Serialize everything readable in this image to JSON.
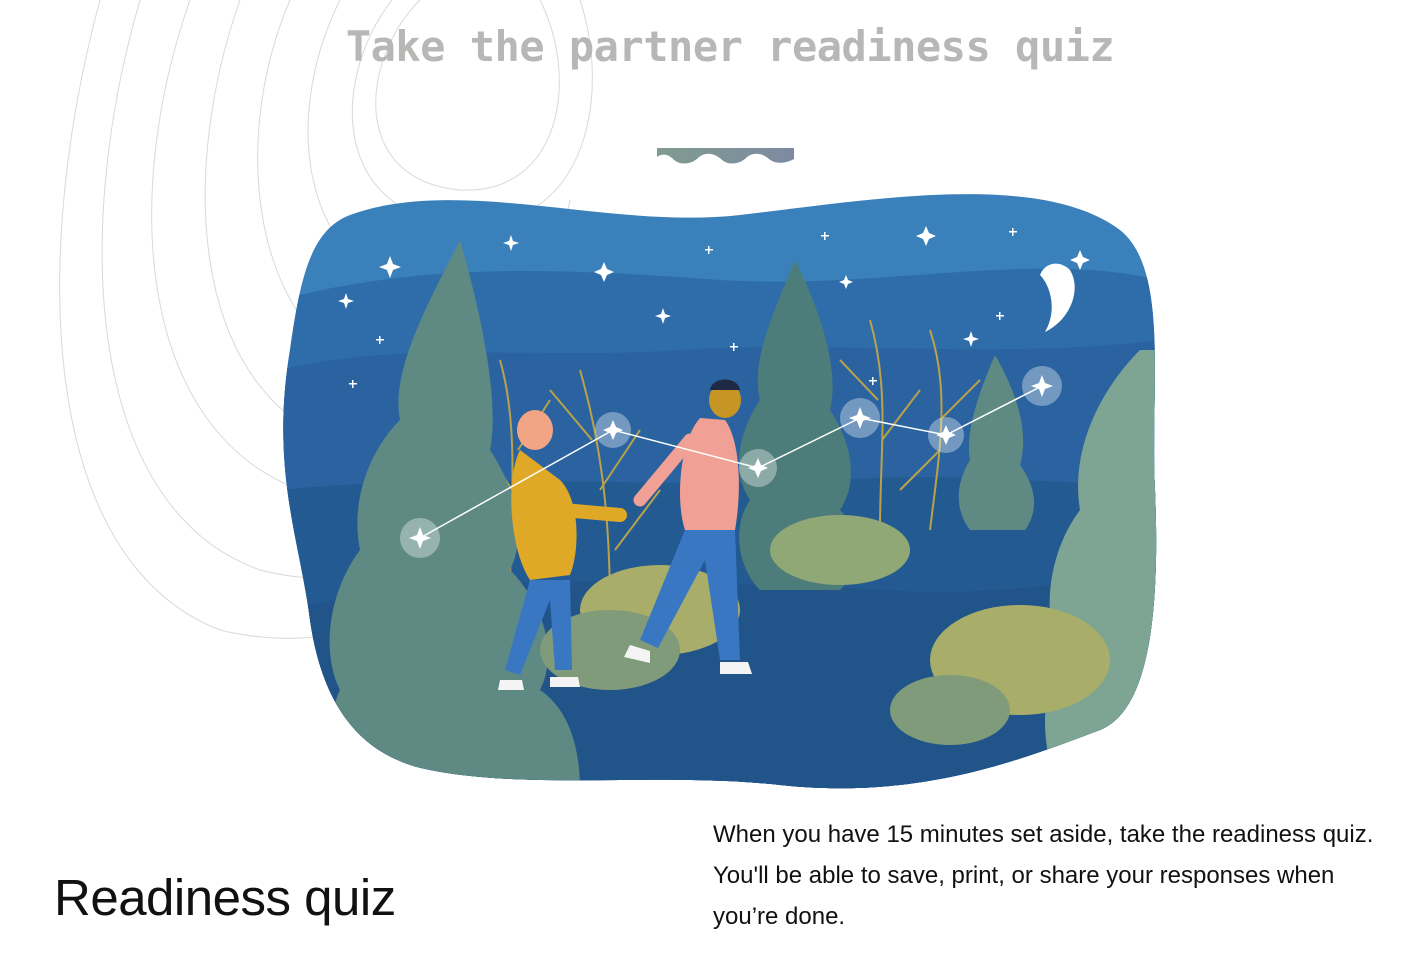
{
  "header": {
    "title": "Take the partner readiness quiz"
  },
  "illustration": {
    "description_icon": "couple-night-walk-illustration"
  },
  "quiz": {
    "heading": "Readiness quiz",
    "description": "When you have 15 minutes set aside, take the readiness quiz. You'll be able to save, print, or share your responses when you’re done."
  },
  "colors": {
    "title_gray": "#b9b7b5",
    "sky_blue": "#3a80ba",
    "deep_blue": "#245a92",
    "tree_green": "#5f8a84",
    "text_black": "#111111"
  }
}
